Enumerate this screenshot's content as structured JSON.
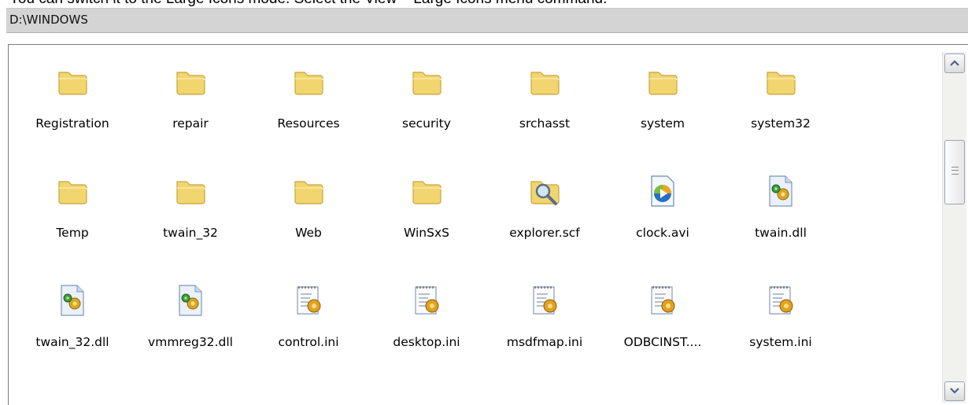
{
  "caption": "You can switch it to the Large Icons mode. Select the View – Large Icons menu command.",
  "window": {
    "path": "D:\\WINDOWS"
  },
  "items": [
    {
      "label": "Registration",
      "icon": "folder-icon"
    },
    {
      "label": "repair",
      "icon": "folder-icon"
    },
    {
      "label": "Resources",
      "icon": "folder-icon"
    },
    {
      "label": "security",
      "icon": "folder-icon"
    },
    {
      "label": "srchasst",
      "icon": "folder-icon"
    },
    {
      "label": "system",
      "icon": "folder-icon"
    },
    {
      "label": "system32",
      "icon": "folder-icon"
    },
    {
      "label": "Temp",
      "icon": "folder-icon"
    },
    {
      "label": "twain_32",
      "icon": "folder-icon"
    },
    {
      "label": "Web",
      "icon": "folder-icon"
    },
    {
      "label": "WinSxS",
      "icon": "folder-icon"
    },
    {
      "label": "explorer.scf",
      "icon": "search-folder-icon"
    },
    {
      "label": "clock.avi",
      "icon": "media-file-icon"
    },
    {
      "label": "twain.dll",
      "icon": "dll-file-icon"
    },
    {
      "label": "twain_32.dll",
      "icon": "dll-file-icon"
    },
    {
      "label": "vmmreg32.dll",
      "icon": "dll-file-icon"
    },
    {
      "label": "control.ini",
      "icon": "ini-file-icon"
    },
    {
      "label": "desktop.ini",
      "icon": "ini-file-icon"
    },
    {
      "label": "msdfmap.ini",
      "icon": "ini-file-icon"
    },
    {
      "label": "ODBCINST....",
      "icon": "ini-file-icon"
    },
    {
      "label": "system.ini",
      "icon": "ini-file-icon"
    }
  ],
  "colors": {
    "folder": "#f1d56e",
    "folder_edge": "#c9a53c"
  }
}
